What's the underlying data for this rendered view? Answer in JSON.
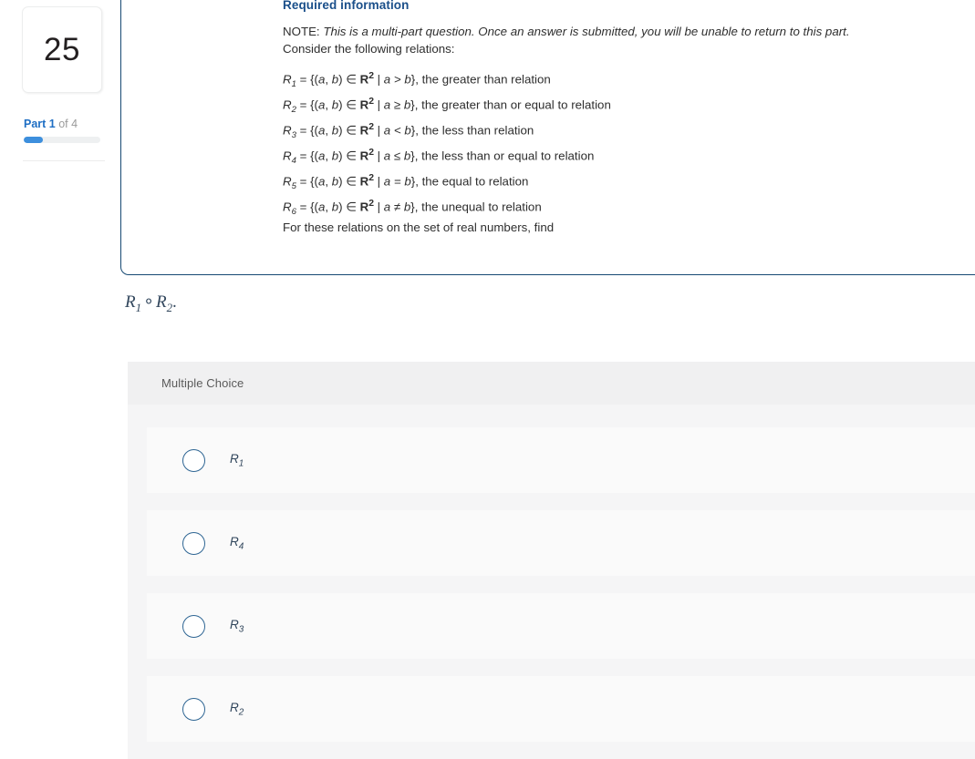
{
  "sidebar": {
    "question_number": "25",
    "part_prefix": "Part 1",
    "part_suffix": " of 4",
    "progress_percent": 25
  },
  "callout": {
    "badge_icon": "exclamation-icon",
    "badge_glyph": "!",
    "title": "Required information",
    "note_prefix": "NOTE: ",
    "note_italic": "This is a multi-part question. Once an answer is submitted, you will be unable to return to this part.",
    "consider": "Consider the following relations:",
    "relations": [
      {
        "name": "R",
        "index": "1",
        "set": "R",
        "exponent": "2",
        "condition": "a > b",
        "description": ", the greater than relation"
      },
      {
        "name": "R",
        "index": "2",
        "set": "R",
        "exponent": "2",
        "condition": "a ≥ b",
        "description": ", the greater than or equal to relation"
      },
      {
        "name": "R",
        "index": "3",
        "set": "R",
        "exponent": "2",
        "condition": "a < b",
        "description": ", the less than relation"
      },
      {
        "name": "R",
        "index": "4",
        "set": "R",
        "exponent": "2",
        "condition": "a ≤ b",
        "description": ", the less than or equal to relation"
      },
      {
        "name": "R",
        "index": "5",
        "set": "R",
        "exponent": "2",
        "condition": "a = b",
        "description": ", the equal to relation"
      },
      {
        "name": "R",
        "index": "6",
        "set": "R",
        "exponent": "2",
        "condition": "a ≠ b",
        "description": ", the unequal to relation"
      }
    ],
    "closing": "For these relations on the set of real numbers, find"
  },
  "prompt": {
    "first_symbol": "R",
    "first_index": "1",
    "operator": "∘",
    "second_symbol": "R",
    "second_index": "2",
    "terminator": "."
  },
  "answer": {
    "header_label": "Multiple Choice",
    "options": [
      {
        "symbol": "R",
        "index": "1",
        "selected": false
      },
      {
        "symbol": "R",
        "index": "4",
        "selected": false
      },
      {
        "symbol": "R",
        "index": "3",
        "selected": false
      },
      {
        "symbol": "R",
        "index": "2",
        "selected": false
      }
    ]
  },
  "colors": {
    "callout_border": "#164973",
    "callout_title": "#1a4f8a",
    "badge_bg": "#1b4f7e",
    "progress_fill": "#3d8fdd",
    "part_accent": "#1f6fc4",
    "radio_border": "#2e6593",
    "answer_header_bg": "#f0f0f1",
    "answer_block_bg": "#f5f5f6",
    "option_row_bg": "#fafafa",
    "math_text": "#31465c"
  }
}
